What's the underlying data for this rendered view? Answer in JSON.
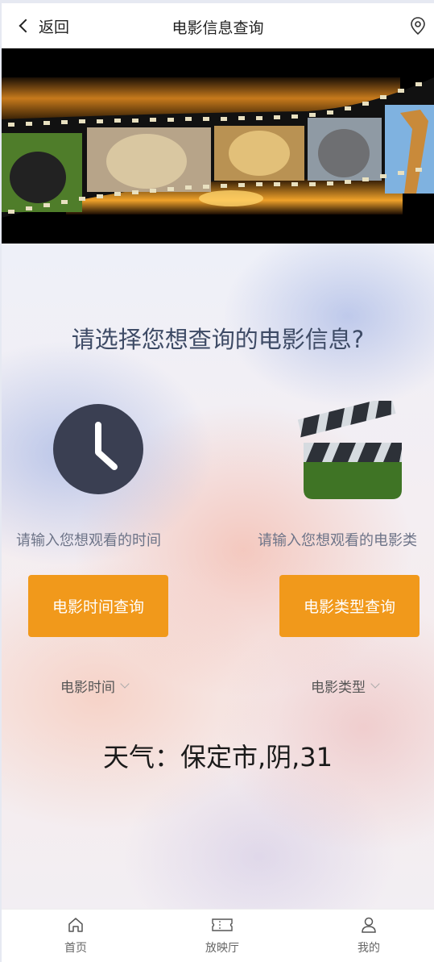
{
  "header": {
    "back_label": "返回",
    "title": "电影信息查询"
  },
  "banner": {
    "description_icon": "film-strip-wildlife-banner"
  },
  "main": {
    "question": "请选择您想查询的电影信息?",
    "left": {
      "hint": "请输入您想观看的时间",
      "button": "电影时间查询",
      "select": "电影时间"
    },
    "right": {
      "hint": "请输入您想观看的电影类",
      "button": "电影类型查询",
      "select": "电影类型"
    },
    "weather": "天气：保定市,阴,31"
  },
  "tabbar": {
    "items": [
      {
        "label": "首页",
        "icon": "home-icon"
      },
      {
        "label": "放映厅",
        "icon": "ticket-icon"
      },
      {
        "label": "我的",
        "icon": "user-icon"
      }
    ]
  },
  "colors": {
    "accent": "#f1991b",
    "clock_face": "#3a3f52",
    "clapper_green": "#3f7425"
  }
}
